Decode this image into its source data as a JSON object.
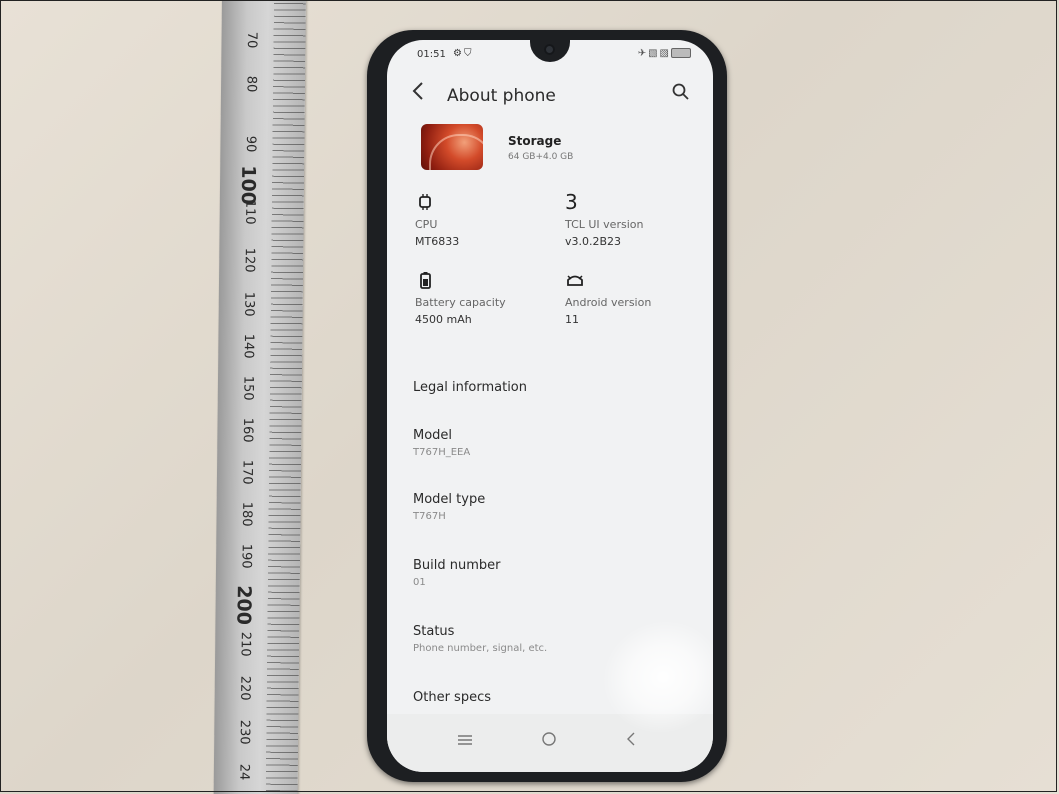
{
  "status_bar": {
    "time": "01:51",
    "left_icons": [
      "gear-icon",
      "shield-icon"
    ],
    "right_icons": [
      "airplane-icon",
      "no-sim-icon",
      "no-sim-icon",
      "battery-icon"
    ]
  },
  "app_bar": {
    "title": "About phone",
    "back_icon": "chevron-left-icon",
    "search_icon": "search-icon"
  },
  "storage": {
    "label": "Storage",
    "value": "64 GB+4.0 GB"
  },
  "specs": [
    {
      "icon": "cpu-icon",
      "label": "CPU",
      "value": "MT6833"
    },
    {
      "icon": "tcl-ui-icon",
      "glyph": "3",
      "label": "TCL UI version",
      "value": "v3.0.2B23"
    },
    {
      "icon": "battery-icon",
      "label": "Battery capacity",
      "value": "4500 mAh"
    },
    {
      "icon": "android-icon",
      "label": "Android version",
      "value": "11"
    }
  ],
  "list": [
    {
      "title": "Legal information",
      "subtitle": ""
    },
    {
      "title": "Model",
      "subtitle": "T767H_EEA"
    },
    {
      "title": "Model type",
      "subtitle": "T767H"
    },
    {
      "title": "Build number",
      "subtitle": "01"
    },
    {
      "title": "Status",
      "subtitle": "Phone number, signal, etc."
    },
    {
      "title": "Other specs",
      "subtitle": ""
    }
  ],
  "nav": {
    "menu_icon": "menu-icon",
    "home_icon": "home-icon",
    "back_icon": "back-icon"
  },
  "ruler": {
    "marks": [
      "70",
      "80",
      "90",
      "100",
      "110",
      "120",
      "130",
      "140",
      "150",
      "160",
      "170",
      "180",
      "190",
      "200",
      "210",
      "220",
      "230",
      "24"
    ]
  },
  "colors": {
    "screen_bg": "#f1f2f3",
    "phone_body": "#1d1f22",
    "desk": "#e4ddd2"
  }
}
